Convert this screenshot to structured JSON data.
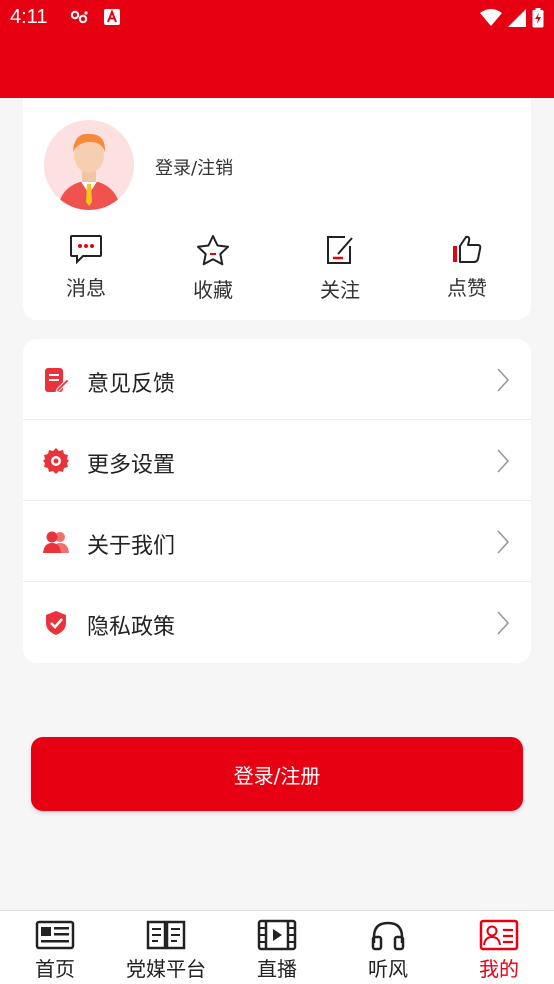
{
  "status_bar": {
    "time": "4:11"
  },
  "profile": {
    "login_text": "登录/注销",
    "quick_actions": [
      {
        "label": "消息",
        "icon": "message-icon"
      },
      {
        "label": "收藏",
        "icon": "star-icon"
      },
      {
        "label": "关注",
        "icon": "edit-note-icon"
      },
      {
        "label": "点赞",
        "icon": "thumbs-up-icon"
      }
    ]
  },
  "menu": {
    "items": [
      {
        "label": "意见反馈",
        "icon": "feedback-icon"
      },
      {
        "label": "更多设置",
        "icon": "gear-icon"
      },
      {
        "label": "关于我们",
        "icon": "users-icon"
      },
      {
        "label": "隐私政策",
        "icon": "shield-icon"
      }
    ]
  },
  "login_button": {
    "label": "登录/注册"
  },
  "bottom_nav": {
    "items": [
      {
        "label": "首页",
        "icon": "newspaper-icon",
        "active": false
      },
      {
        "label": "党媒平台",
        "icon": "book-icon",
        "active": false
      },
      {
        "label": "直播",
        "icon": "film-icon",
        "active": false
      },
      {
        "label": "听风",
        "icon": "headphones-icon",
        "active": false
      },
      {
        "label": "我的",
        "icon": "profile-card-icon",
        "active": true
      }
    ]
  },
  "colors": {
    "brand": "#e60012",
    "background": "#f6f6f6"
  }
}
